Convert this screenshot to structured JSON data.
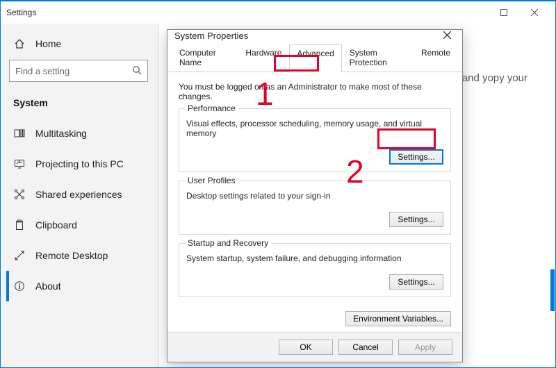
{
  "settings": {
    "title": "Settings",
    "home": "Home",
    "search_placeholder": "Find a setting",
    "category": "System",
    "nav": [
      {
        "label": "Multitasking"
      },
      {
        "label": "Projecting to this PC"
      },
      {
        "label": "Shared experiences"
      },
      {
        "label": "Clipboard"
      },
      {
        "label": "Remote Desktop"
      },
      {
        "label": "About"
      }
    ],
    "content_fragment": "re, and yopy your"
  },
  "dialog": {
    "title": "System Properties",
    "tabs": {
      "computer_name": "Computer Name",
      "hardware": "Hardware",
      "advanced": "Advanced",
      "system_protection": "System Protection",
      "remote": "Remote"
    },
    "note": "You must be logged on as an Administrator to make most of these changes.",
    "performance": {
      "legend": "Performance",
      "desc": "Visual effects, processor scheduling, memory usage, and virtual memory",
      "button": "Settings..."
    },
    "user_profiles": {
      "legend": "User Profiles",
      "desc": "Desktop settings related to your sign-in",
      "button": "Settings..."
    },
    "startup": {
      "legend": "Startup and Recovery",
      "desc": "System startup, system failure, and debugging information",
      "button": "Settings..."
    },
    "env_button": "Environment Variables...",
    "ok": "OK",
    "cancel": "Cancel",
    "apply": "Apply"
  },
  "annotations": {
    "n1": "1",
    "n2": "2"
  }
}
